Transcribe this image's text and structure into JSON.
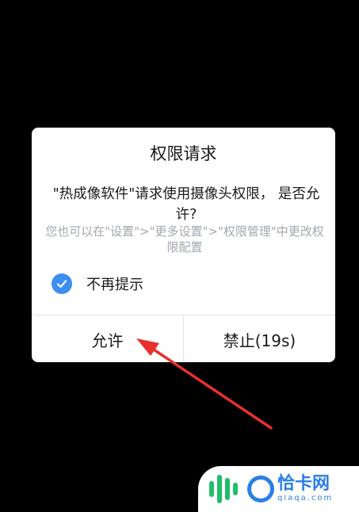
{
  "dialog": {
    "title": "权限请求",
    "message": "\"热成像软件\"请求使用摄像头权限， 是否允许?",
    "hint": "您也可以在\"设置\">\"更多设置\">\"权限管理\"中更改权限配置",
    "checkbox": {
      "label": "不再提示",
      "checked": true
    },
    "allow_label": "允许",
    "deny_label": "禁止(19s)"
  },
  "watermark": {
    "name": "恰卡网",
    "domain": "qiaqa.com"
  },
  "colors": {
    "accent": "#3d8ef0",
    "arrow": "#e8302d",
    "watermark": "#2b7fe6"
  }
}
